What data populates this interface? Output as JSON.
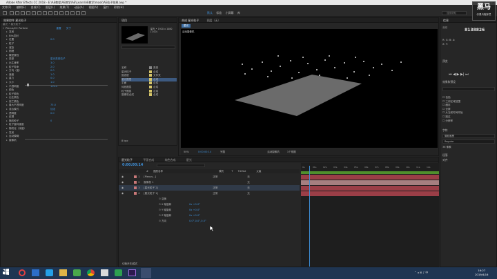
{
  "app": {
    "title": "Adobe After Effects CC 2018 - E:\\AE教程\\AE教学\\AE\\Learn\\AE教学\\mask\\AE粒子效果.aep *",
    "menu": [
      "文件(F)",
      "编辑(E)",
      "合成(C)",
      "图层(L)",
      "效果(T)",
      "动画(A)",
      "视图(V)",
      "窗口",
      "帮助(H)"
    ],
    "workspace": [
      "默认",
      "标准",
      "小屏幕",
      "库"
    ],
    "search_placeholder": "搜索帮助"
  },
  "effects_panel": {
    "tabs": [
      "效果控件 星光粒子",
      "项目"
    ],
    "breadcrumb": "星光 • 星光粒子",
    "effect_name": "Plexus/CC Particle",
    "reset_label": "重置",
    "about_label": "关于",
    "rows": [
      {
        "label": "发射",
        "value": ""
      },
      {
        "label": "Bits发射",
        "value": ""
      },
      {
        "label": "位置",
        "value": "0.0"
      },
      {
        "label": "粒子",
        "value": ""
      },
      {
        "label": "渲染",
        "value": ""
      },
      {
        "label": "物理",
        "value": ""
      },
      {
        "label": "模型属性",
        "value": ""
      },
      {
        "label": "类型",
        "value": "星光类型粒子"
      },
      {
        "label": "出生速率",
        "value": "3.0"
      },
      {
        "label": "粒子寿命",
        "value": "2.0"
      },
      {
        "label": "方向（度）",
        "value": "0.0"
      },
      {
        "label": "速度",
        "value": "1.0"
      },
      {
        "label": "重力",
        "value": "0.0"
      },
      {
        "label": "大小",
        "value": "1.0"
      },
      {
        "label": "不透明度",
        "value": "100.0"
      },
      {
        "label": "颜色",
        "value": ""
      },
      {
        "label": "粒子颜色",
        "value": ""
      },
      {
        "label": "出生颜色",
        "value": ""
      },
      {
        "label": "死亡颜色",
        "value": ""
      },
      {
        "label": "最大不透明度",
        "value": "75.0"
      },
      {
        "label": "混合模式",
        "value": "加法"
      },
      {
        "label": "透明度",
        "value": "0.0"
      },
      {
        "label": "纹理",
        "value": ""
      },
      {
        "label": "随机种子",
        "value": "0"
      },
      {
        "label": "粒子旋转速度",
        "value": ""
      },
      {
        "label": "随机化（深度）",
        "value": ""
      },
      {
        "label": "发射",
        "value": ""
      },
      {
        "label": "运动模糊",
        "value": ""
      },
      {
        "label": "摄像机",
        "value": ""
      }
    ]
  },
  "project_panel": {
    "tabs": [
      "项目"
    ],
    "thumb_info": "星光 • 1920 x 1080 (1.00)",
    "items": [
      {
        "name": "名称",
        "kind": "类型",
        "color": "#888888"
      },
      {
        "name": "星光粒子",
        "kind": "合成",
        "color": "#d6c66a"
      },
      {
        "name": "固态层",
        "kind": "文件夹",
        "color": "#d6c66a"
      },
      {
        "name": "星光图层",
        "kind": "合成",
        "color": "#d6c66a"
      },
      {
        "name": "平面",
        "kind": "合成",
        "color": "#d6c66a"
      },
      {
        "name": "纯色图层",
        "kind": "合成",
        "color": "#d6c66a"
      },
      {
        "name": "粒子图层",
        "kind": "合成",
        "color": "#d6c66a"
      },
      {
        "name": "摄像机合成",
        "kind": "合成",
        "color": "#d6c66a"
      }
    ],
    "footer": "8 bpc"
  },
  "composition_panel": {
    "tabs": [
      "合成 星光粒子",
      "图层（无）"
    ],
    "comp_label": "星光",
    "active_camera": "活动摄像机",
    "zoom": "50%",
    "timecode": "0:00:00:14",
    "quality": "完整",
    "view_label": "活动摄像机",
    "views": "1个视图"
  },
  "right_panel": {
    "info_label": "信息",
    "coords": "8138826",
    "audio_label": "音频",
    "preview_label": "预览",
    "effects_label": "效果和预设",
    "align_label": "对齐",
    "character_label": "字符",
    "paragraph_label": "段落",
    "font": "微软雅黑",
    "font_style": "Regular",
    "font_size": "36 像素",
    "options": [
      "包括",
      "工作区域范围",
      "缓存",
      "全屏",
      "从当前时间开始",
      "跳过",
      "分辨率"
    ]
  },
  "timeline": {
    "tabs": [
      "星光粒子",
      "平面合成",
      "纯色合成",
      "星光"
    ],
    "timecode": "0:00:00:14",
    "search_placeholder": "搜索",
    "headers": [
      "#",
      "图层名称",
      "模式",
      "T",
      "TrkMat",
      "父级"
    ],
    "layers": [
      {
        "num": "1",
        "name": "[Plexus...]",
        "mode": "正常",
        "parent": "无",
        "color": "#c87878"
      },
      {
        "num": "2",
        "name": "摄像机 1",
        "mode": "",
        "parent": "无",
        "color": "#c87878"
      },
      {
        "num": "3",
        "name": "[星光粒子 2]",
        "mode": "正常",
        "parent": "无",
        "color": "#c87878"
      },
      {
        "num": "4",
        "name": "[星光粒子 1]",
        "mode": "正常",
        "parent": "无",
        "color": "#c87878"
      }
    ],
    "sublayers": [
      "变换",
      "X 轴旋转",
      "Y 轴旋转",
      "Z 轴旋转",
      "方向"
    ],
    "sub_values": [
      "0x +0.0°",
      "0x +0.0°",
      "0x +0.0°",
      "0.0°,0.0°,0.0°"
    ],
    "ruler": [
      "0s",
      "01s",
      "02s",
      "03s",
      "04s",
      "05s",
      "06s",
      "07s",
      "08s",
      "09s",
      "10s",
      "11s",
      "12s"
    ],
    "footer": "切换开关/模式"
  },
  "watermark": {
    "brand": "黑马",
    "sub": "@黑马程序员"
  },
  "taskbar": {
    "time": "16:27",
    "date": "2019/4/16",
    "apps": [
      "start",
      "search",
      "task-view",
      "ie",
      "explorer",
      "store",
      "chrome",
      "word",
      "excel",
      "premiere",
      "after-effects"
    ]
  }
}
